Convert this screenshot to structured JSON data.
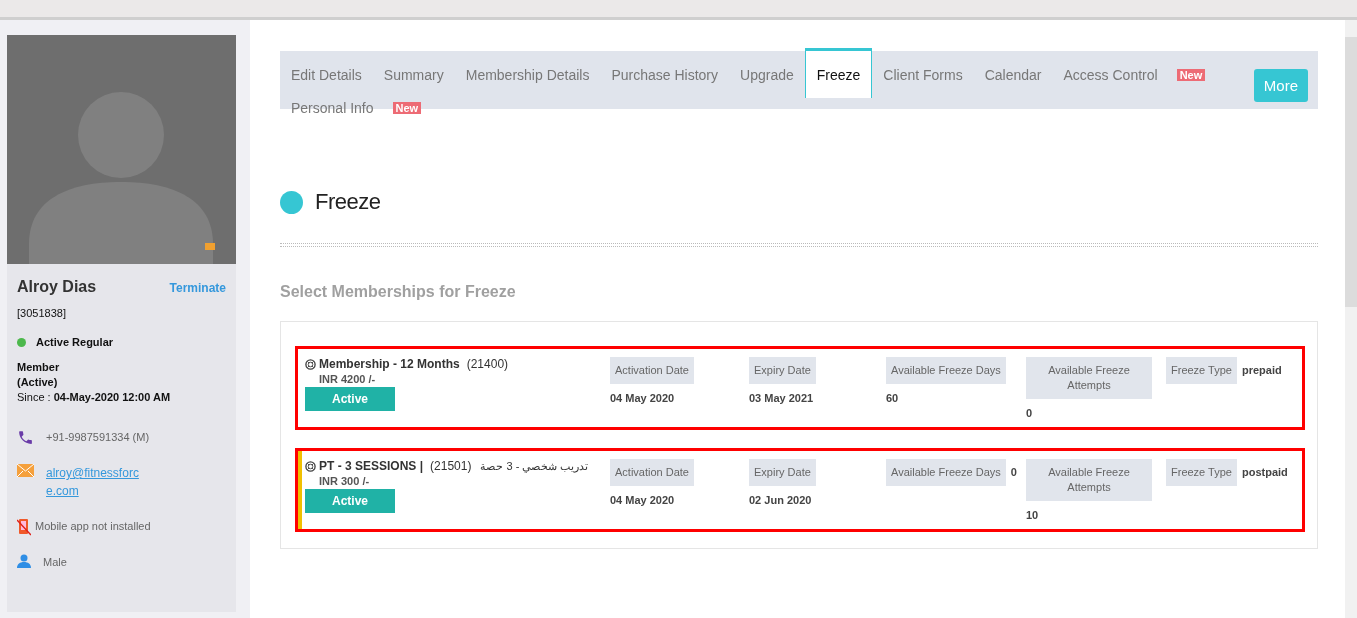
{
  "profile": {
    "name": "Alroy Dias",
    "action": "Terminate",
    "member_id": "[3051838]",
    "status": {
      "label": "Active Regular",
      "color": "#4cb84c"
    },
    "membership_type": "Member",
    "membership_state": "(Active)",
    "since": "Since : **04-May-2020 12:00 AM**",
    "contacts": [
      {
        "kind": "phone",
        "text": "+91-9987591334 (M)"
      },
      {
        "kind": "email",
        "text": "alroy@fitnessforce.com"
      },
      {
        "kind": "app",
        "text": "Mobile app not installed"
      },
      {
        "kind": "gender",
        "text": "Male"
      }
    ]
  },
  "tabs": [
    {
      "label": "Edit Details",
      "selected": false
    },
    {
      "label": "Summary",
      "selected": false
    },
    {
      "label": "Membership Details",
      "selected": false
    },
    {
      "label": "Purchase History",
      "selected": false
    },
    {
      "label": "Upgrade",
      "selected": false
    },
    {
      "label": "Freeze",
      "selected": true
    },
    {
      "label": "Client Forms",
      "selected": false
    },
    {
      "label": "Calendar",
      "selected": false
    },
    {
      "label": "Access Control",
      "selected": false,
      "badge": "New"
    },
    {
      "label": "Personal Info",
      "selected": false,
      "badge": "New"
    }
  ],
  "more_button": "More",
  "section_title": "Freeze",
  "subtitle": "Select Memberships for Freeze",
  "memberships": [
    {
      "name": "Membership - 12 Months",
      "code": "(21400)",
      "price": "INR 4200 /-",
      "status": "Active",
      "highlighted": false,
      "fields": [
        {
          "kind": "stacked",
          "label": "Activation Date",
          "value": "04 May 2020"
        },
        {
          "kind": "stacked",
          "label": "Expiry Date",
          "value": "03 May 2021"
        },
        {
          "kind": "stacked",
          "label": "Available Freeze Days",
          "value": "60"
        },
        {
          "kind": "stacked",
          "label": "Available Freeze Attempts",
          "value": "0"
        },
        {
          "kind": "inline",
          "label": "Freeze Type",
          "value": "prepaid"
        }
      ]
    },
    {
      "name": "PT - 3 SESSIONS |",
      "code": "(21501)",
      "native_name": "تدريب شخصي - 3 حصة",
      "price": "INR 300 /-",
      "status": "Active",
      "highlighted": true,
      "fields": [
        {
          "kind": "stacked",
          "label": "Activation Date",
          "value": "04 May 2020"
        },
        {
          "kind": "stacked",
          "label": "Expiry Date",
          "value": "02 Jun 2020"
        },
        {
          "kind": "inline",
          "label": "Available Freeze Days",
          "value": "0"
        },
        {
          "kind": "stacked",
          "label": "Available Freeze Attempts",
          "value": "10"
        },
        {
          "kind": "inline",
          "label": "Freeze Type",
          "value": "postpaid"
        }
      ]
    }
  ]
}
